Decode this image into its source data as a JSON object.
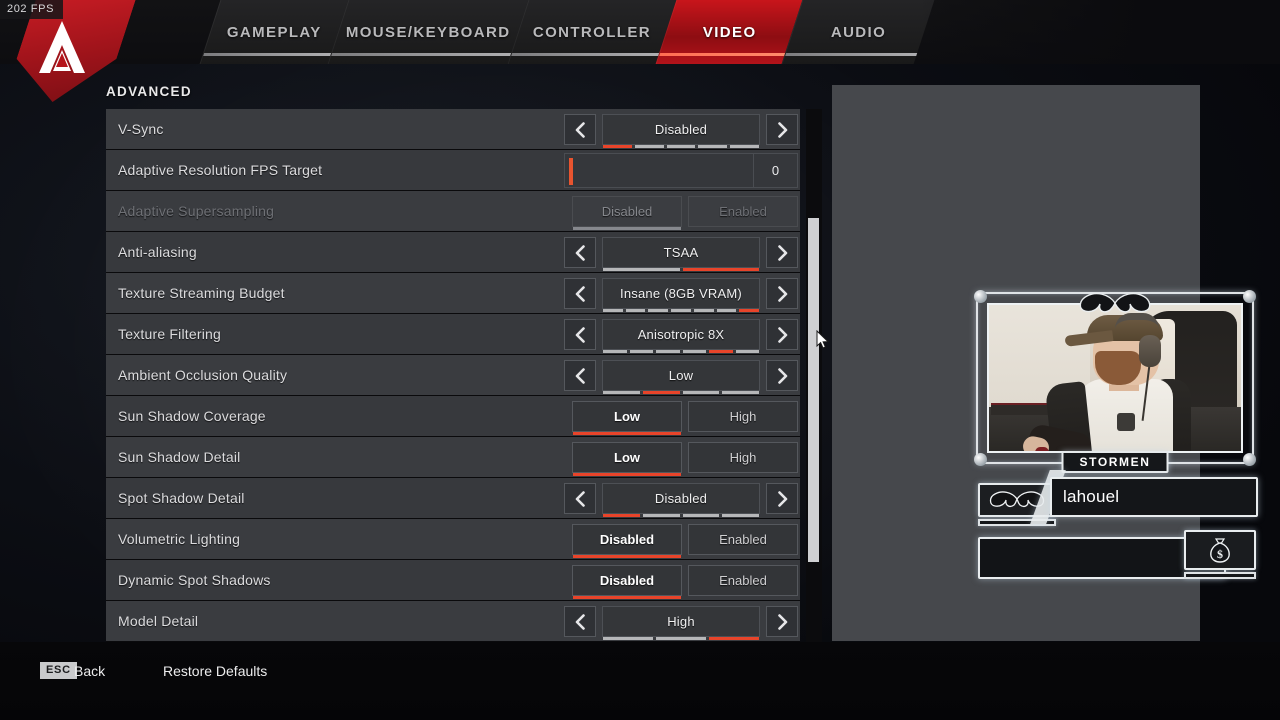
{
  "hud": {
    "fps": "202 FPS",
    "logo_icon": "apex-legends-logo"
  },
  "nav": {
    "tabs": [
      {
        "label": "GAMEPLAY",
        "active": false
      },
      {
        "label": "MOUSE/KEYBOARD",
        "active": false
      },
      {
        "label": "CONTROLLER",
        "active": false
      },
      {
        "label": "VIDEO",
        "active": true
      },
      {
        "label": "AUDIO",
        "active": false
      }
    ],
    "active_color": "#c8151b"
  },
  "section": {
    "title": "ADVANCED"
  },
  "settings": {
    "rows": [
      {
        "label": "V-Sync",
        "type": "selector",
        "value": "Disabled",
        "segments": 5,
        "active_segment": 1,
        "disabled": false
      },
      {
        "label": "Adaptive Resolution FPS Target",
        "type": "slider",
        "value": "0",
        "fill_percent": 0,
        "disabled": false
      },
      {
        "label": "Adaptive Supersampling",
        "type": "toggle",
        "options": [
          "Disabled",
          "Enabled"
        ],
        "selected": "Disabled",
        "disabled": true
      },
      {
        "label": "Anti-aliasing",
        "type": "selector",
        "value": "TSAA",
        "segments": 2,
        "active_segment": 2,
        "disabled": false
      },
      {
        "label": "Texture Streaming Budget",
        "type": "selector",
        "value": "Insane (8GB VRAM)",
        "segments": 7,
        "active_segment": 7,
        "disabled": false
      },
      {
        "label": "Texture Filtering",
        "type": "selector",
        "value": "Anisotropic 8X",
        "segments": 6,
        "active_segment": 5,
        "disabled": false
      },
      {
        "label": "Ambient Occlusion Quality",
        "type": "selector",
        "value": "Low",
        "segments": 4,
        "active_segment": 2,
        "disabled": false
      },
      {
        "label": "Sun Shadow Coverage",
        "type": "toggle",
        "options": [
          "Low",
          "High"
        ],
        "selected": "Low",
        "disabled": false
      },
      {
        "label": "Sun Shadow Detail",
        "type": "toggle",
        "options": [
          "Low",
          "High"
        ],
        "selected": "Low",
        "disabled": false
      },
      {
        "label": "Spot Shadow Detail",
        "type": "selector",
        "value": "Disabled",
        "segments": 4,
        "active_segment": 1,
        "disabled": false
      },
      {
        "label": "Volumetric Lighting",
        "type": "toggle",
        "options": [
          "Disabled",
          "Enabled"
        ],
        "selected": "Disabled",
        "disabled": false
      },
      {
        "label": "Dynamic Spot Shadows",
        "type": "toggle",
        "options": [
          "Disabled",
          "Enabled"
        ],
        "selected": "Disabled",
        "disabled": false
      },
      {
        "label": "Model Detail",
        "type": "selector",
        "value": "High",
        "segments": 3,
        "active_segment": 3,
        "disabled": false
      }
    ],
    "arrow_left_icon": "chevron-left-icon",
    "arrow_right_icon": "chevron-right-icon",
    "accent_color": "#e8442a"
  },
  "overlay": {
    "webcam_label": "STORMEN",
    "user_name": "lahouel",
    "mustache_icon": "mustache-icon",
    "money_icon": "money-bag-icon",
    "webcam_icon": "webcam-feed"
  },
  "footer": {
    "esc_key": "ESC",
    "back_label": "Back",
    "restore_label": "Restore Defaults"
  },
  "cursor": {
    "icon": "mouse-pointer-icon"
  }
}
